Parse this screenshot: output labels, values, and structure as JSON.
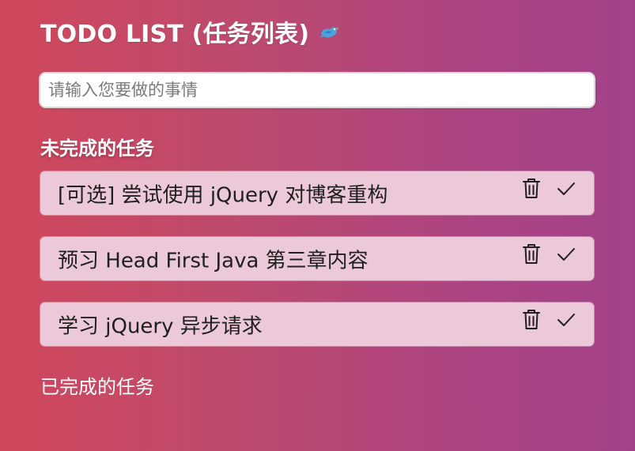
{
  "header": {
    "title": "TODO LIST (任务列表)",
    "logo_icon": "bird-icon"
  },
  "input": {
    "placeholder": "请输入您要做的事情",
    "value": ""
  },
  "sections": {
    "pending_title": "未完成的任务",
    "done_title": "已完成的任务"
  },
  "tasks": [
    {
      "text": "[可选] 尝试使用 jQuery 对博客重构",
      "delete_icon": "trash-icon",
      "complete_icon": "check-icon"
    },
    {
      "text": "预习 Head First Java 第三章内容",
      "delete_icon": "trash-icon",
      "complete_icon": "check-icon"
    },
    {
      "text": "学习 jQuery 异步请求",
      "delete_icon": "trash-icon",
      "complete_icon": "check-icon"
    }
  ],
  "colors": {
    "background_start": "#d0485c",
    "background_end": "#a3428a",
    "task_background": "#ebc9d8",
    "bird": "#4aa3df"
  }
}
